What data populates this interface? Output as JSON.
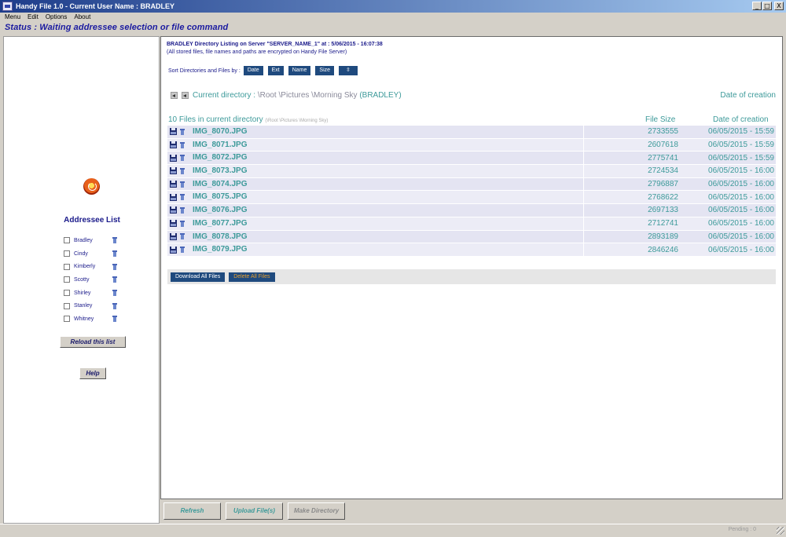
{
  "window": {
    "title": "Handy File 1.0 - Current User Name : BRADLEY",
    "buttons": [
      "_",
      "□",
      "X"
    ]
  },
  "menu": [
    "Menu",
    "Edit",
    "Options",
    "About"
  ],
  "status": "Status : Waiting addressee selection or file command",
  "sidebar": {
    "addressee_title": "Addressee List",
    "addressees": [
      "Bradley",
      "Cindy",
      "Kimberly",
      "Scotty",
      "Shirley",
      "Stanley",
      "Whitney"
    ],
    "reload_label": "Reload this list",
    "help_label": "Help"
  },
  "listing": {
    "header_line1": "BRADLEY Directory Listing on Server \"SERVER_NAME_1\" at : 5/06/2015 - 16:07:38",
    "header_line2": "(All stored files, file names and paths are encrypted on Handy File Server)",
    "sort_label": "Sort Directories and Files by :",
    "sort_buttons": [
      "Date",
      "Ext",
      "Name",
      "Size",
      "⇳"
    ],
    "current_dir_label": "Current directory :",
    "current_dir_path": "\\Root \\Pictures \\Morning Sky",
    "current_dir_user": "(BRADLEY)",
    "date_creation_header": "Date of creation",
    "files_count": "10 Files in current directory",
    "files_path_small": "(\\Root \\Pictures \\Morning Sky)",
    "col_file_size": "File Size",
    "col_date": "Date of creation",
    "files": [
      {
        "name": "IMG_8070.JPG",
        "size": "2733555",
        "date": "06/05/2015 - 15:59"
      },
      {
        "name": "IMG_8071.JPG",
        "size": "2607618",
        "date": "06/05/2015 - 15:59"
      },
      {
        "name": "IMG_8072.JPG",
        "size": "2775741",
        "date": "06/05/2015 - 15:59"
      },
      {
        "name": "IMG_8073.JPG",
        "size": "2724534",
        "date": "06/05/2015 - 16:00"
      },
      {
        "name": "IMG_8074.JPG",
        "size": "2796887",
        "date": "06/05/2015 - 16:00"
      },
      {
        "name": "IMG_8075.JPG",
        "size": "2768622",
        "date": "06/05/2015 - 16:00"
      },
      {
        "name": "IMG_8076.JPG",
        "size": "2697133",
        "date": "06/05/2015 - 16:00"
      },
      {
        "name": "IMG_8077.JPG",
        "size": "2712741",
        "date": "06/05/2015 - 16:00"
      },
      {
        "name": "IMG_8078.JPG",
        "size": "2893189",
        "date": "06/05/2015 - 16:00"
      },
      {
        "name": "IMG_8079.JPG",
        "size": "2846246",
        "date": "06/05/2015 - 16:00"
      }
    ],
    "download_all_label": "Download All Files",
    "delete_all_label": "Delete All Files"
  },
  "bottom_buttons": {
    "refresh": "Refresh",
    "upload": "Upload File(s)",
    "make_dir": "Make Directory"
  },
  "statusbar": {
    "pending": "Pending : 0"
  }
}
